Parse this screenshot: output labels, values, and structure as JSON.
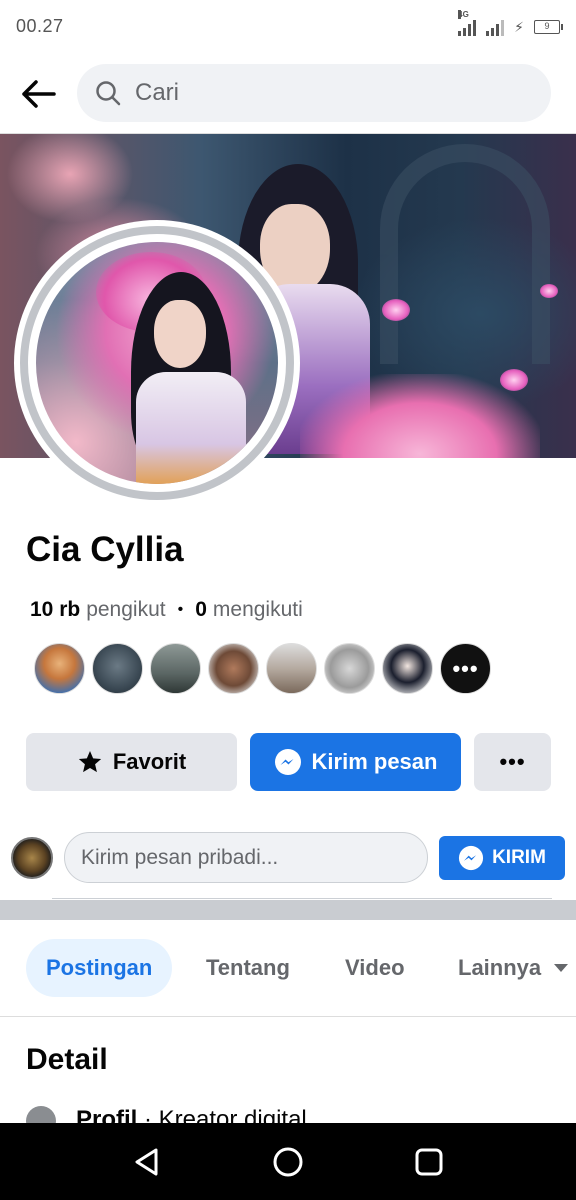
{
  "status_bar": {
    "time": "00.27",
    "network": "4G",
    "battery": "9"
  },
  "search": {
    "placeholder": "Cari"
  },
  "profile": {
    "name": "Cia Cyllia",
    "followers_count": "10 rb",
    "followers_label": "pengikut",
    "following_count": "0",
    "following_label": "mengikuti",
    "more_followers": "•••"
  },
  "actions": {
    "favorite_label": "Favorit",
    "message_label": "Kirim pesan",
    "more_label": "•••"
  },
  "message_box": {
    "placeholder": "Kirim pesan pribadi...",
    "send_label": "KIRIM"
  },
  "tabs": [
    {
      "label": "Postingan"
    },
    {
      "label": "Tentang"
    },
    {
      "label": "Video"
    },
    {
      "label": "Lainnya"
    }
  ],
  "details": {
    "title": "Detail",
    "profile_key": "Profil",
    "profile_value": " · Kreator digital"
  },
  "colors": {
    "accent": "#1b74e4",
    "tab_active_bg": "#e7f3ff",
    "button_gray": "#e4e6eb"
  }
}
